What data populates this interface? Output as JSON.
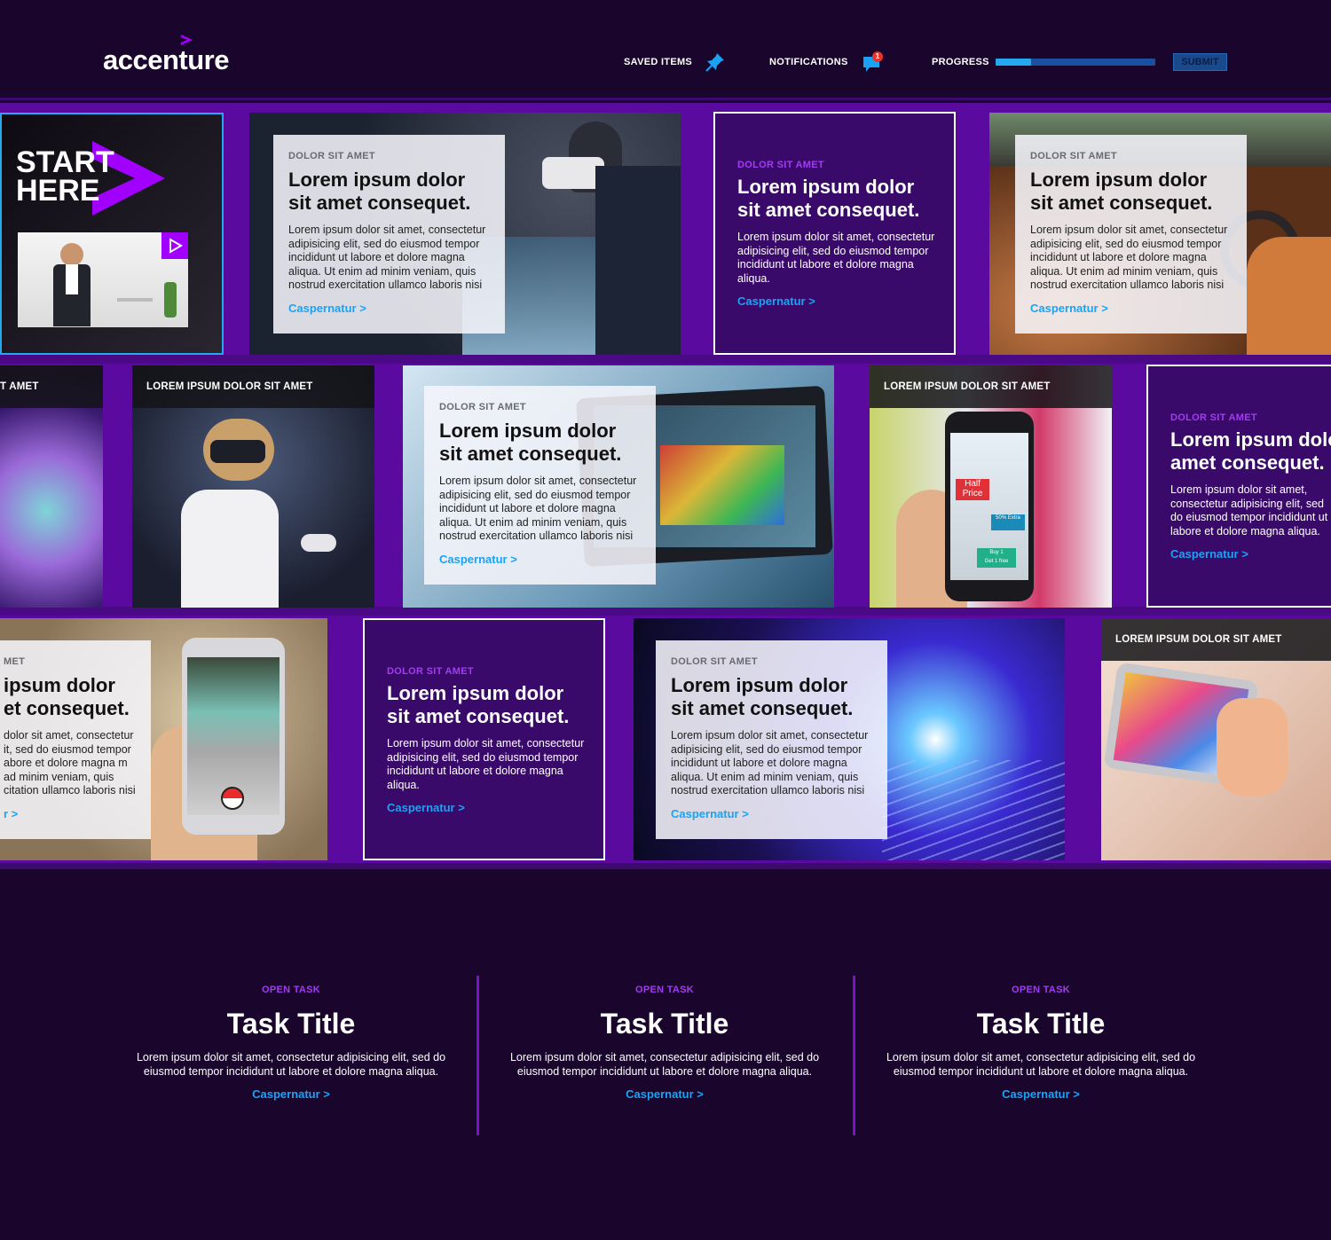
{
  "header": {
    "logo_text": "accenture",
    "saved_label": "SAVED ITEMS",
    "notifications_label": "NOTIFICATIONS",
    "notification_count": "1",
    "progress_label": "PROGRESS",
    "progress_fraction": 0.22,
    "submit_label": "SUBMIT"
  },
  "start": {
    "line1": "START",
    "line2": "HERE"
  },
  "tiles": {
    "r1t2": {
      "kicker": "DOLOR SIT AMET",
      "heading": "Lorem ipsum dolor sit amet consequet.",
      "body": "Lorem ipsum dolor sit amet, consectetur adipisicing elit, sed do eiusmod tempor incididunt ut labore et dolore magna aliqua. Ut enim ad minim veniam, quis nostrud exercitation ullamco laboris nisi",
      "link": "Caspernatur >"
    },
    "r1t3": {
      "kicker": "DOLOR SIT AMET",
      "heading": "Lorem ipsum dolor sit amet consequet.",
      "body": "Lorem ipsum dolor sit amet, consectetur adipisicing elit, sed do eiusmod tempor incididunt ut labore et dolore magna aliqua.",
      "link": "Caspernatur >"
    },
    "r1t4": {
      "kicker": "DOLOR SIT AMET",
      "heading": "Lorem ipsum dolor sit amet consequet.",
      "body": "Lorem ipsum dolor sit amet, consectetur adipisicing elit, sed do eiusmod tempor incididunt ut labore et dolore magna aliqua. Ut enim ad minim veniam, quis nostrud exercitation ullamco laboris nisi",
      "link": "Caspernatur >"
    },
    "r2t1": {
      "label": "T AMET"
    },
    "r2t2": {
      "label": "LOREM IPSUM DOLOR SIT AMET"
    },
    "r2t3": {
      "kicker": "DOLOR SIT AMET",
      "heading": "Lorem ipsum dolor sit amet consequet.",
      "body": "Lorem ipsum dolor sit amet, consectetur adipisicing elit, sed do eiusmod tempor incididunt ut labore et dolore magna aliqua. Ut enim ad minim veniam, quis nostrud exercitation ullamco laboris nisi",
      "link": "Caspernatur >"
    },
    "r2t4": {
      "label": "LOREM IPSUM DOLOR SIT AMET"
    },
    "r2t5": {
      "kicker": "DOLOR SIT AMET",
      "heading": "Lorem ipsum dolor sit amet consequet.",
      "body": "Lorem ipsum dolor sit amet, consectetur adipisicing elit, sed do eiusmod tempor incididunt ut labore et dolore magna aliqua.",
      "link": "Caspernatur >"
    },
    "r3t1": {
      "kicker": "MET",
      "heading": "ipsum dolor et consequet.",
      "body": "dolor sit amet, consectetur it, sed do eiusmod tempor abore et dolore magna m ad minim veniam, quis citation ullamco laboris nisi",
      "link": "r >"
    },
    "r3t2": {
      "kicker": "DOLOR SIT AMET",
      "heading": "Lorem ipsum dolor sit amet consequet.",
      "body": "Lorem ipsum dolor sit amet, consectetur adipisicing elit, sed do eiusmod tempor incididunt ut labore et dolore magna aliqua.",
      "link": "Caspernatur >"
    },
    "r3t3": {
      "kicker": "DOLOR SIT AMET",
      "heading": "Lorem ipsum dolor sit amet consequet.",
      "body": "Lorem ipsum dolor sit amet, consectetur adipisicing elit, sed do eiusmod tempor incididunt ut labore et dolore magna aliqua. Ut enim ad minim veniam, quis nostrud exercitation ullamco laboris nisi",
      "link": "Caspernatur >"
    },
    "r3t4": {
      "label": "LOREM IPSUM DOLOR SIT AMET"
    }
  },
  "phone_ad": {
    "line1": "Half",
    "line2": "Price",
    "line3": "50% Extra",
    "line4": "Buy 1",
    "line5": "Get 1 free"
  },
  "tasks": [
    {
      "kicker": "OPEN TASK",
      "title": "Task Title",
      "body": "Lorem ipsum dolor sit amet, consectetur adipisicing elit, sed do eiusmod tempor incididunt ut labore et dolore magna aliqua.",
      "link": "Caspernatur >"
    },
    {
      "kicker": "OPEN TASK",
      "title": "Task Title",
      "body": "Lorem ipsum dolor sit amet, consectetur adipisicing elit, sed do eiusmod tempor incididunt ut labore et dolore magna aliqua.",
      "link": "Caspernatur >"
    },
    {
      "kicker": "OPEN TASK",
      "title": "Task Title",
      "body": "Lorem ipsum dolor sit amet, consectetur adipisicing elit, sed do eiusmod tempor incididunt ut labore et dolore magna aliqua.",
      "link": "Caspernatur >"
    }
  ],
  "colors": {
    "accent_purple": "#a100ff",
    "link_blue": "#1aa3f5",
    "background": "#1a052c",
    "board": "#5a0a9e"
  }
}
